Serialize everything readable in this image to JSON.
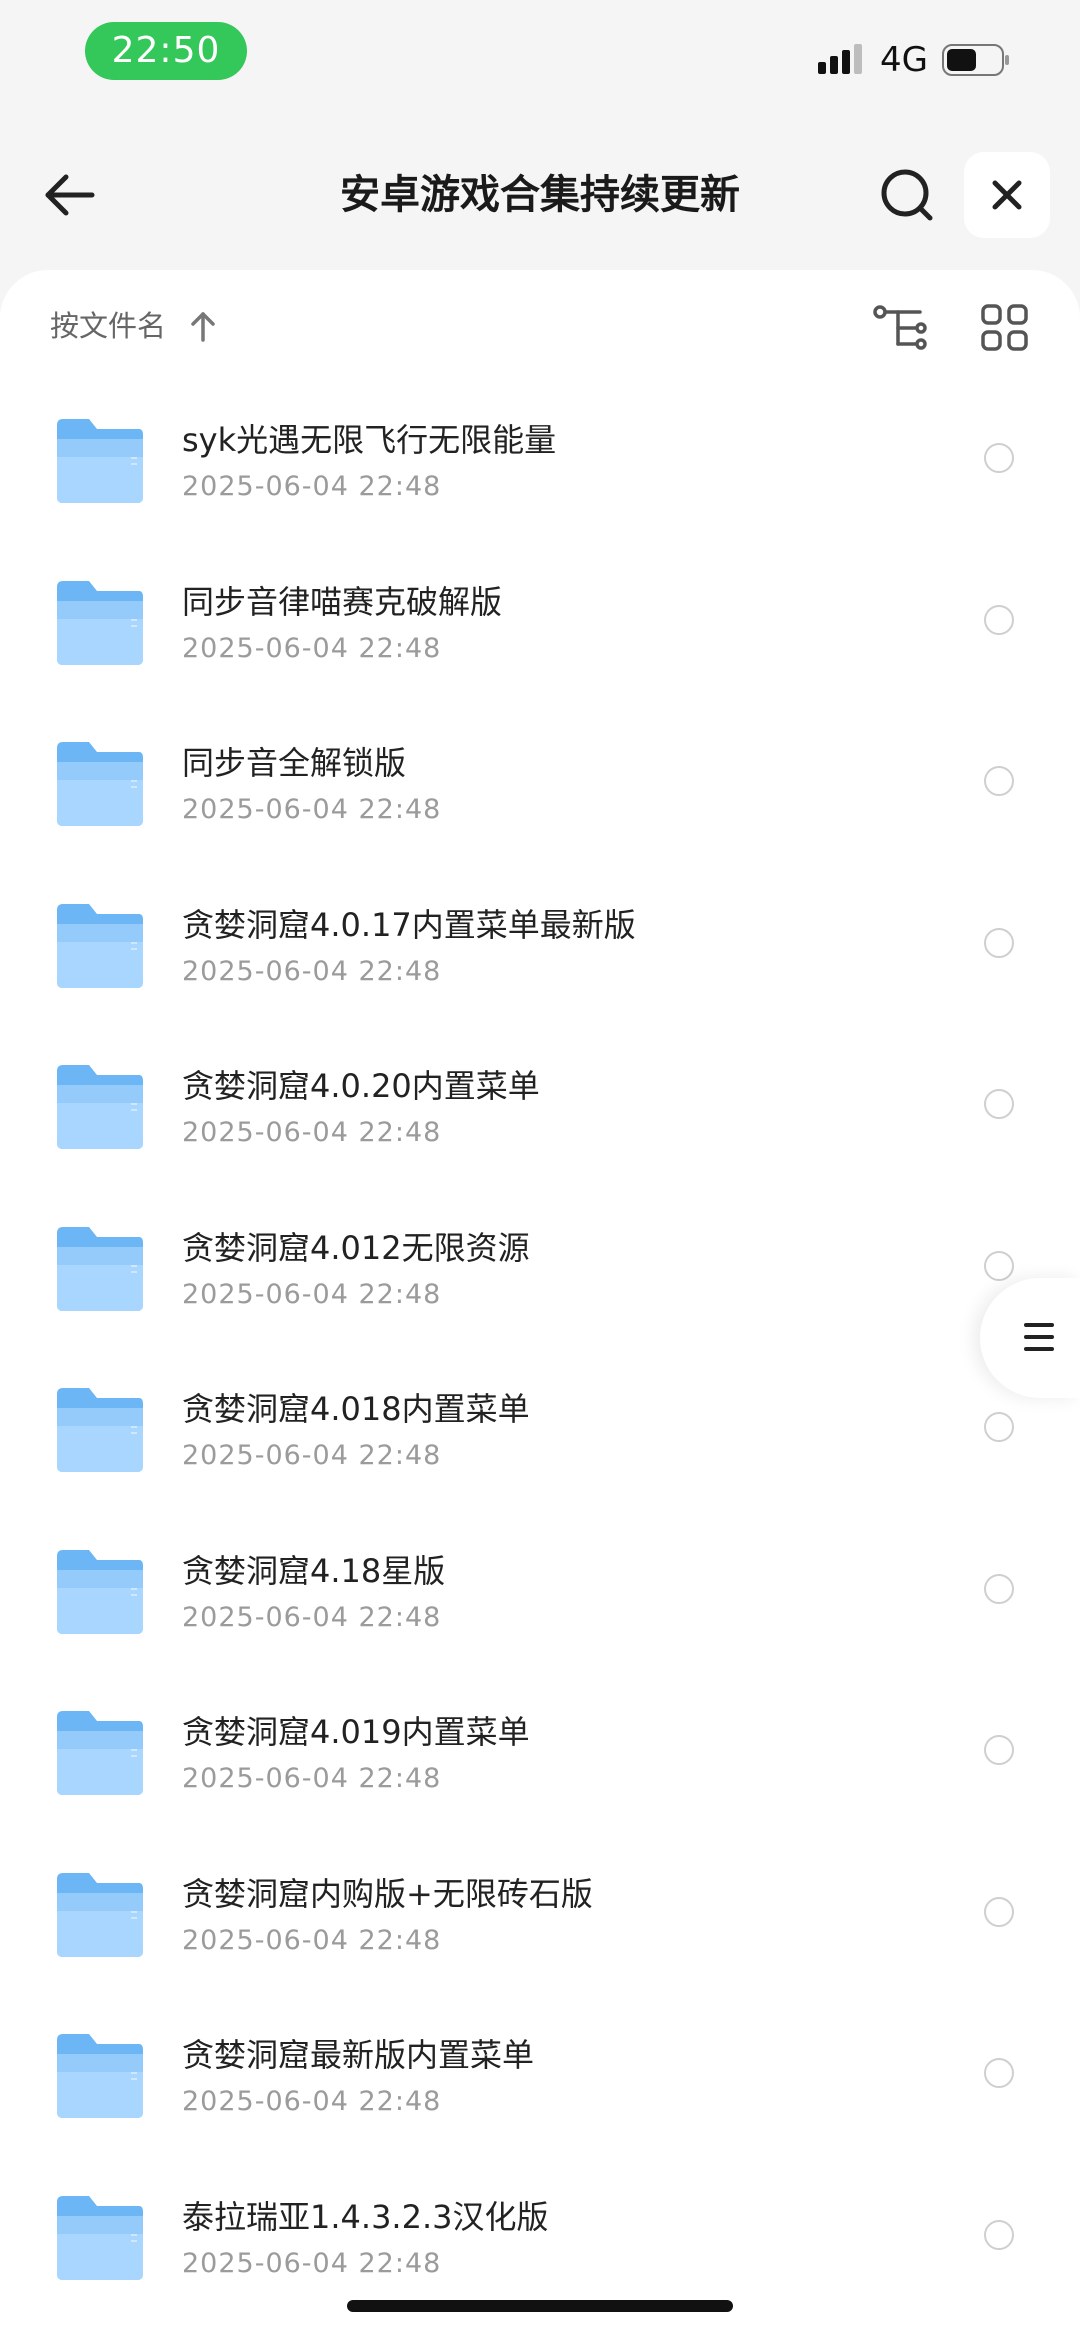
{
  "status_bar": {
    "time": "22:50",
    "network": "4G",
    "time_pill_color": "#34c759",
    "battery_level": 0.55
  },
  "header": {
    "title": "安卓游戏合集持续更新",
    "icons": [
      "arrow-left-icon",
      "search-icon",
      "close-icon"
    ]
  },
  "sort_bar": {
    "label": "按文件名",
    "direction": "ascending",
    "icons": [
      "sort-arrow-up-icon",
      "tree-view-icon",
      "grid-view-icon"
    ]
  },
  "files": [
    {
      "name": "syk光遇无限飞行无限能量",
      "date": "2025-06-04 22:48"
    },
    {
      "name": "同步音律喵赛克破解版",
      "date": "2025-06-04 22:48"
    },
    {
      "name": "同步音全解锁版",
      "date": "2025-06-04 22:48"
    },
    {
      "name": "贪婪洞窟4.0.17内置菜单最新版",
      "date": "2025-06-04 22:48"
    },
    {
      "name": "贪婪洞窟4.0.20内置菜单",
      "date": "2025-06-04 22:48"
    },
    {
      "name": "贪婪洞窟4.012无限资源",
      "date": "2025-06-04 22:48"
    },
    {
      "name": "贪婪洞窟4.018内置菜单",
      "date": "2025-06-04 22:48"
    },
    {
      "name": "贪婪洞窟4.18星版",
      "date": "2025-06-04 22:48"
    },
    {
      "name": "贪婪洞窟4.019内置菜单",
      "date": "2025-06-04 22:48"
    },
    {
      "name": "贪婪洞窟内购版+无限砖石版",
      "date": "2025-06-04 22:48"
    },
    {
      "name": "贪婪洞窟最新版内置菜单",
      "date": "2025-06-04 22:48"
    },
    {
      "name": "泰拉瑞亚1.4.3.2.3汉化版",
      "date": "2025-06-04 22:48"
    }
  ],
  "colors": {
    "folder": "#6cb6f5",
    "folder_light": "#a9d6ff",
    "background": "#f5f5f5",
    "sheet": "#ffffff"
  },
  "side_handle_icon": "menu-icon"
}
